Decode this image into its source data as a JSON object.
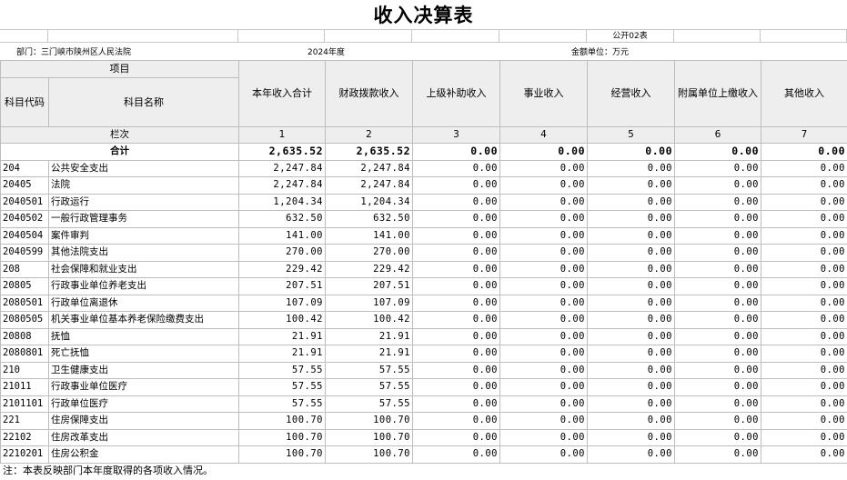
{
  "header": {
    "title": "收入决算表",
    "form_code": "公开02表",
    "department": "部门：三门峡市陕州区人民法院",
    "year": "2024年度",
    "unit": "金额单位：万元"
  },
  "columns": {
    "item_header": "项目",
    "code_header": "科目代码",
    "name_header": "科目名称",
    "col_labels": [
      "本年收入合计",
      "财政拨款收入",
      "上级补助收入",
      "事业收入",
      "经营收入",
      "附属单位上缴收入",
      "其他收入"
    ],
    "index_label": "栏次",
    "col_indexes": [
      "1",
      "2",
      "3",
      "4",
      "5",
      "6",
      "7"
    ]
  },
  "total": {
    "label": "合计",
    "values": [
      "2,635.52",
      "2,635.52",
      "0.00",
      "0.00",
      "0.00",
      "0.00",
      "0.00"
    ]
  },
  "rows": [
    {
      "code": "204",
      "name": "公共安全支出",
      "values": [
        "2,247.84",
        "2,247.84",
        "0.00",
        "0.00",
        "0.00",
        "0.00",
        "0.00"
      ]
    },
    {
      "code": "20405",
      "name": "法院",
      "values": [
        "2,247.84",
        "2,247.84",
        "0.00",
        "0.00",
        "0.00",
        "0.00",
        "0.00"
      ]
    },
    {
      "code": "2040501",
      "name": "行政运行",
      "values": [
        "1,204.34",
        "1,204.34",
        "0.00",
        "0.00",
        "0.00",
        "0.00",
        "0.00"
      ]
    },
    {
      "code": "2040502",
      "name": "一般行政管理事务",
      "values": [
        "632.50",
        "632.50",
        "0.00",
        "0.00",
        "0.00",
        "0.00",
        "0.00"
      ]
    },
    {
      "code": "2040504",
      "name": "案件审判",
      "values": [
        "141.00",
        "141.00",
        "0.00",
        "0.00",
        "0.00",
        "0.00",
        "0.00"
      ]
    },
    {
      "code": "2040599",
      "name": "其他法院支出",
      "values": [
        "270.00",
        "270.00",
        "0.00",
        "0.00",
        "0.00",
        "0.00",
        "0.00"
      ]
    },
    {
      "code": "208",
      "name": "社会保障和就业支出",
      "values": [
        "229.42",
        "229.42",
        "0.00",
        "0.00",
        "0.00",
        "0.00",
        "0.00"
      ]
    },
    {
      "code": "20805",
      "name": "行政事业单位养老支出",
      "values": [
        "207.51",
        "207.51",
        "0.00",
        "0.00",
        "0.00",
        "0.00",
        "0.00"
      ]
    },
    {
      "code": "2080501",
      "name": "行政单位离退休",
      "values": [
        "107.09",
        "107.09",
        "0.00",
        "0.00",
        "0.00",
        "0.00",
        "0.00"
      ]
    },
    {
      "code": "2080505",
      "name": "机关事业单位基本养老保险缴费支出",
      "values": [
        "100.42",
        "100.42",
        "0.00",
        "0.00",
        "0.00",
        "0.00",
        "0.00"
      ]
    },
    {
      "code": "20808",
      "name": "抚恤",
      "values": [
        "21.91",
        "21.91",
        "0.00",
        "0.00",
        "0.00",
        "0.00",
        "0.00"
      ]
    },
    {
      "code": "2080801",
      "name": "死亡抚恤",
      "values": [
        "21.91",
        "21.91",
        "0.00",
        "0.00",
        "0.00",
        "0.00",
        "0.00"
      ]
    },
    {
      "code": "210",
      "name": "卫生健康支出",
      "values": [
        "57.55",
        "57.55",
        "0.00",
        "0.00",
        "0.00",
        "0.00",
        "0.00"
      ]
    },
    {
      "code": "21011",
      "name": "行政事业单位医疗",
      "values": [
        "57.55",
        "57.55",
        "0.00",
        "0.00",
        "0.00",
        "0.00",
        "0.00"
      ]
    },
    {
      "code": "2101101",
      "name": "行政单位医疗",
      "values": [
        "57.55",
        "57.55",
        "0.00",
        "0.00",
        "0.00",
        "0.00",
        "0.00"
      ]
    },
    {
      "code": "221",
      "name": "住房保障支出",
      "values": [
        "100.70",
        "100.70",
        "0.00",
        "0.00",
        "0.00",
        "0.00",
        "0.00"
      ]
    },
    {
      "code": "22102",
      "name": "住房改革支出",
      "values": [
        "100.70",
        "100.70",
        "0.00",
        "0.00",
        "0.00",
        "0.00",
        "0.00"
      ]
    },
    {
      "code": "2210201",
      "name": "住房公积金",
      "values": [
        "100.70",
        "100.70",
        "0.00",
        "0.00",
        "0.00",
        "0.00",
        "0.00"
      ]
    }
  ],
  "footer": {
    "note": "注：本表反映部门本年度取得的各项收入情况。"
  }
}
